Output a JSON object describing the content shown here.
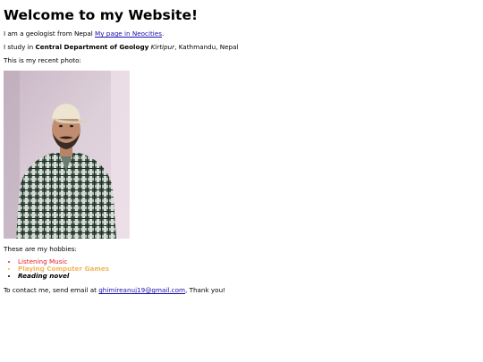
{
  "heading": "Welcome to my Website!",
  "intro": {
    "text": "I am a geologist from Nepal ",
    "link": "My page in Neocities",
    "after": "."
  },
  "study": {
    "prefix": "I study in ",
    "dept": "Central Department of Geology",
    "place_italic": "Kirtipur",
    "suffix": ", Kathmandu, Nepal"
  },
  "photo_caption": "This is my recent photo:",
  "hobbies": {
    "title": "These are my hobbies:",
    "items": [
      "Listening Music",
      "Playing Computer Games",
      "Reading novel"
    ]
  },
  "contact": {
    "prefix": "To contact me, send email at ",
    "email": "ghimireanuj19@gmail.com",
    "suffix": ", Thank you!"
  },
  "colors": {
    "link": "#1a0dab",
    "hobby_1": "#e8202a",
    "hobby_2": "#f0b65a",
    "hobby_3": "#000000"
  }
}
